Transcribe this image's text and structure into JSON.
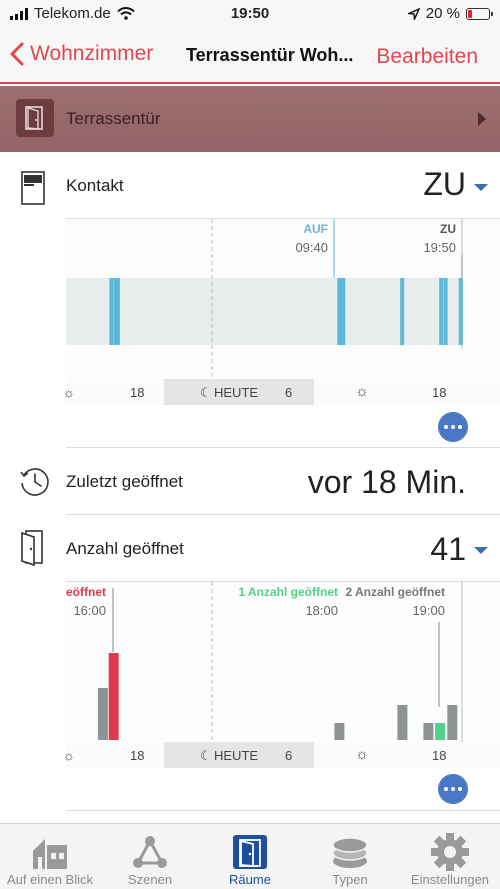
{
  "status": {
    "carrier": "Telekom.de",
    "time": "19:50",
    "battery": "20 %",
    "battery_level": 0.2
  },
  "nav": {
    "back_label": "Wohnzimmer",
    "title": "Terrassentür Woh...",
    "edit_label": "Bearbeiten"
  },
  "banner": {
    "label": "Terrassentür"
  },
  "kontakt": {
    "label": "Kontakt",
    "value": "ZU",
    "markers": [
      {
        "label": "AUF",
        "time": "09:40"
      },
      {
        "label": "ZU",
        "time": "19:50"
      }
    ],
    "axis": {
      "start": "☼",
      "t1": "18",
      "heute": "HEUTE",
      "t2": "6",
      "t3": "18"
    }
  },
  "zuletzt": {
    "label": "Zuletzt geöffnet",
    "value": "vor 18 Min."
  },
  "anzahl": {
    "label": "Anzahl geöffnet",
    "value": "41",
    "markers": [
      {
        "label": "geöffnet",
        "time": "16:00"
      },
      {
        "label": "1 Anzahl geöffnet",
        "time": "18:00"
      },
      {
        "label": "2 Anzahl geöffnet",
        "time": "19:00"
      }
    ],
    "axis": {
      "start": "☼",
      "t1": "18",
      "heute": "HEUTE",
      "t2": "6",
      "t3": "18"
    }
  },
  "chart_data": [
    {
      "type": "timeline",
      "title": "",
      "state_now": "ZU",
      "open_events_relative": [
        0.1,
        0.11,
        0.115,
        0.625,
        0.77,
        0.86,
        0.87,
        0.905
      ]
    },
    {
      "type": "bar",
      "title": "",
      "bars": [
        {
          "pos": 0.085,
          "value": 52,
          "color": "#8e9496"
        },
        {
          "pos": 0.11,
          "value": 87,
          "color": "#e0384e"
        },
        {
          "pos": 0.63,
          "value": 17,
          "color": "#8e9496"
        },
        {
          "pos": 0.775,
          "value": 35,
          "color": "#8e9496"
        },
        {
          "pos": 0.835,
          "value": 17,
          "color": "#8e9496"
        },
        {
          "pos": 0.862,
          "value": 17,
          "color": "#4fd28a"
        },
        {
          "pos": 0.89,
          "value": 35,
          "color": "#8e9496"
        }
      ],
      "ylim": [
        0,
        100
      ]
    }
  ],
  "tabs": [
    {
      "label": "Auf einen Blick",
      "icon": "house-icon",
      "active": false
    },
    {
      "label": "Szenen",
      "icon": "scenes-icon",
      "active": false
    },
    {
      "label": "Räume",
      "icon": "door-icon",
      "active": true
    },
    {
      "label": "Typen",
      "icon": "layers-icon",
      "active": false
    },
    {
      "label": "Einstellungen",
      "icon": "gear-icon",
      "active": false
    }
  ],
  "colors": {
    "accent": "#e0484e",
    "banner": "#986b6c",
    "blue": "#4a78c4",
    "event": "#5bb8d6"
  }
}
